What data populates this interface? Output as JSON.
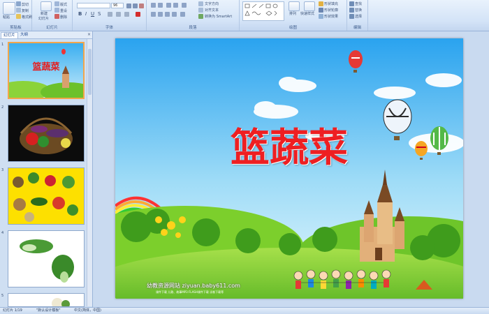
{
  "ribbon": {
    "groups": {
      "clipboard": "剪贴板",
      "slides": "幻灯片",
      "font": "字体",
      "paragraph": "段落",
      "drawing": "绘图",
      "editing": "编辑"
    },
    "clipboard": {
      "paste": "粘贴",
      "cut": "剪切",
      "copy": "复制",
      "format_painter": "格式刷"
    },
    "slides": {
      "new_slide": "新建",
      "new_slide_line2": "幻灯片",
      "layout": "版式",
      "reset": "重设",
      "delete": "删除"
    },
    "font": {
      "size": "96"
    },
    "paragraph": {
      "text_direction": "文字方向",
      "align_text": "对齐文本",
      "smartart": "转换为 SmartArt"
    },
    "drawing": {
      "arrange": "排列",
      "quick_styles": "快速样式",
      "shape_fill": "形状填充",
      "shape_outline": "形状轮廓",
      "shape_effects": "形状效果"
    },
    "editing": {
      "find": "查找",
      "replace": "替换",
      "select": "选择"
    }
  },
  "left_pane": {
    "tabs": [
      "幻灯片",
      "大纲"
    ],
    "close": "×",
    "slides": [
      {
        "num": "1",
        "title": "篮蔬菜"
      },
      {
        "num": "2"
      },
      {
        "num": "3"
      },
      {
        "num": "4"
      },
      {
        "num": "5"
      }
    ]
  },
  "slide": {
    "title": "篮蔬菜",
    "watermark": "幼教资源网站  ziyuan.baby611.com",
    "watermark_sub": "课件下载    儿歌、故事MP3    FLASH课件下载    试卷下载等"
  },
  "statusbar": {
    "slide_count": "幻灯片 1/19",
    "theme": "\"默认设计模板\"",
    "language": "中文(简体，中国)"
  }
}
